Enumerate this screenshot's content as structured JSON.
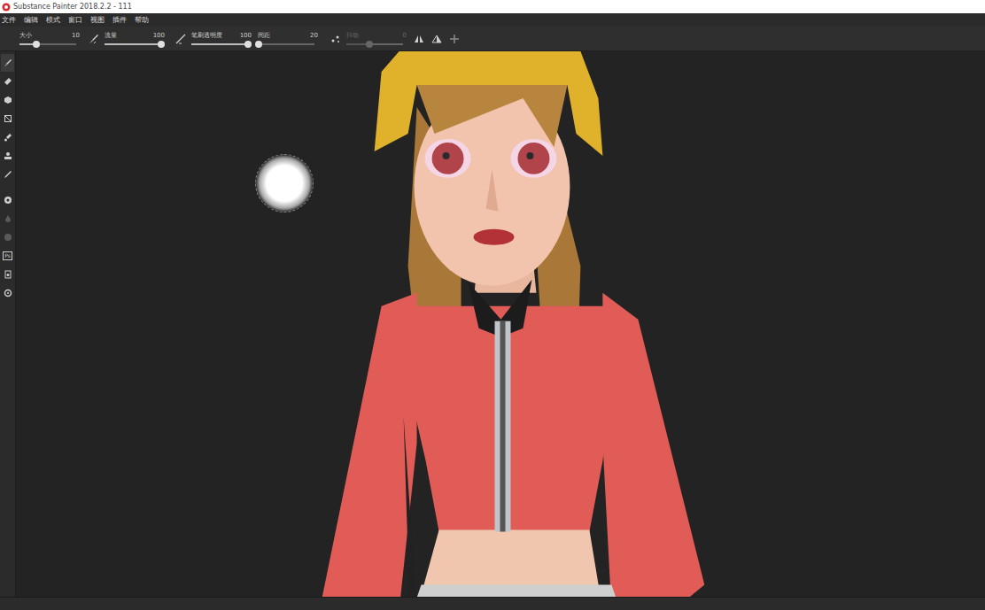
{
  "window": {
    "title": "Substance Painter 2018.2.2 - 111"
  },
  "menu": [
    "文件",
    "编辑",
    "模式",
    "窗口",
    "视图",
    "插件",
    "帮助"
  ],
  "tool_options": [
    {
      "label": "大小",
      "value": "10",
      "level": 0.3,
      "disabled": false,
      "kind": "plain"
    },
    {
      "label": "流量",
      "value": "100",
      "level": 1.0,
      "disabled": false,
      "kind": "brush"
    },
    {
      "label": "笔刷透明度",
      "value": "100",
      "level": 1.0,
      "disabled": false,
      "kind": "stroke"
    },
    {
      "label": "间距",
      "value": "20",
      "level": 0.02,
      "disabled": false,
      "kind": "plain"
    },
    {
      "label": "抖动",
      "value": "0",
      "level": 0.4,
      "disabled": true,
      "kind": "jitter"
    }
  ],
  "left_tools": [
    {
      "kind": "brush",
      "selected": true,
      "disabled": false,
      "label": ""
    },
    {
      "kind": "eraser",
      "selected": false,
      "disabled": false,
      "label": ""
    },
    {
      "kind": "projection",
      "selected": false,
      "disabled": false,
      "label": ""
    },
    {
      "kind": "polyfill",
      "selected": false,
      "disabled": false,
      "label": ""
    },
    {
      "kind": "smudge",
      "selected": false,
      "disabled": false,
      "label": ""
    },
    {
      "kind": "clone",
      "selected": false,
      "disabled": false,
      "label": ""
    },
    {
      "kind": "picker",
      "selected": false,
      "disabled": false,
      "label": ""
    },
    {
      "kind": "material",
      "selected": false,
      "disabled": false,
      "label": ""
    },
    {
      "kind": "drop",
      "selected": false,
      "disabled": true,
      "label": ""
    },
    {
      "kind": "disc",
      "selected": false,
      "disabled": true,
      "label": ""
    },
    {
      "kind": "text",
      "selected": false,
      "disabled": false,
      "label": "Ps"
    },
    {
      "kind": "export",
      "selected": false,
      "disabled": false,
      "label": ""
    },
    {
      "kind": "settings",
      "selected": false,
      "disabled": false,
      "label": ""
    }
  ]
}
